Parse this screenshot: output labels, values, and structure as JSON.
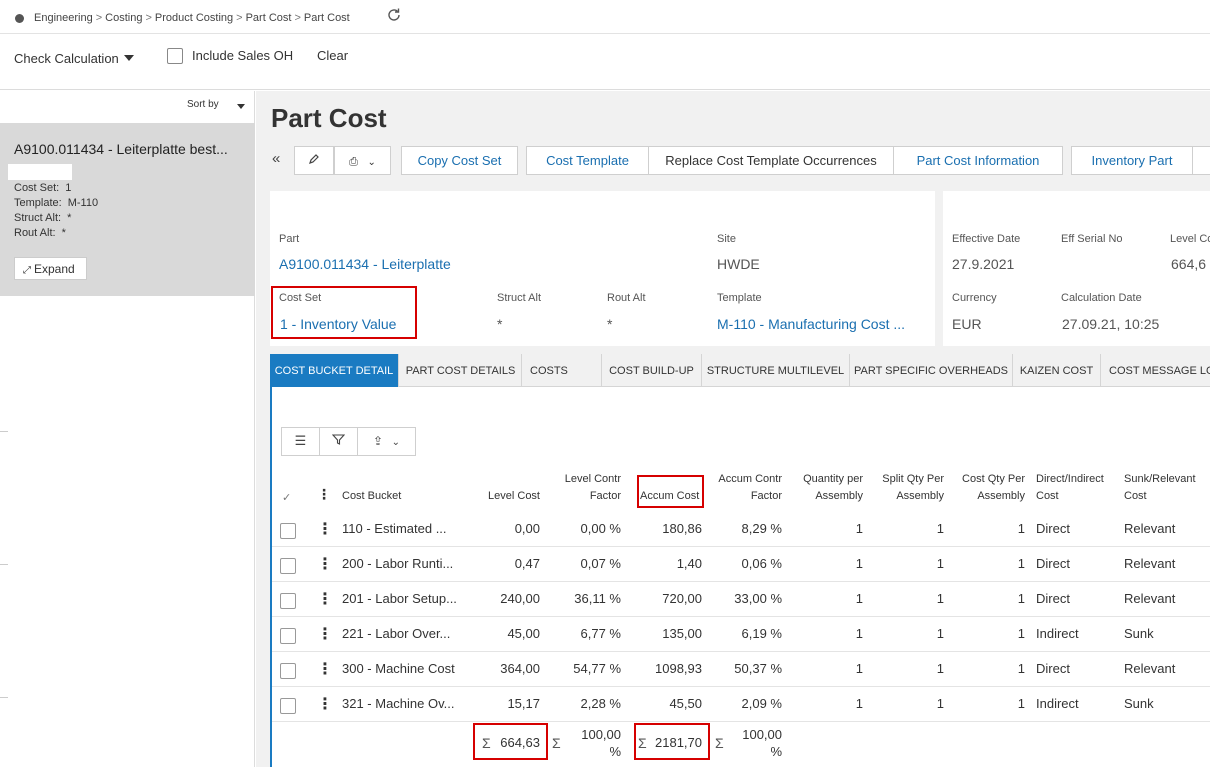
{
  "breadcrumb": [
    "Engineering",
    "Costing",
    "Product Costing",
    "Part Cost",
    "Part Cost"
  ],
  "toolbar": {
    "check_calc": "Check Calculation",
    "include_sales_oh": "Include Sales OH",
    "clear": "Clear"
  },
  "sidebar": {
    "sort_by": "Sort by",
    "card_title": "A9100.011434 - Leiterplatte best...",
    "cost_set_label": "Cost Set:",
    "cost_set_value": "1",
    "template_label": "Template:",
    "template_value": "M-110",
    "struct_alt_label": "Struct Alt:",
    "struct_alt_value": "*",
    "rout_alt_label": "Rout Alt:",
    "rout_alt_value": "*",
    "expand": "Expand"
  },
  "page": {
    "title": "Part Cost",
    "buttons": {
      "copy_cost_set": "Copy Cost Set",
      "cost_template": "Cost Template",
      "replace_template": "Replace Cost Template Occurrences",
      "part_cost_info": "Part Cost Information",
      "inventory_part": "Inventory Part"
    }
  },
  "details": {
    "part_label": "Part",
    "part_value": "A9100.011434 - Leiterplatte",
    "site_label": "Site",
    "site_value": "HWDE",
    "cost_set_label": "Cost Set",
    "cost_set_value": "1 - Inventory Value",
    "struct_alt_label": "Struct Alt",
    "struct_alt_value": "*",
    "rout_alt_label": "Rout Alt",
    "rout_alt_value": "*",
    "template_label": "Template",
    "template_value": "M-110 - Manufacturing Cost ...",
    "eff_date_label": "Effective Date",
    "eff_date_value": "27.9.2021",
    "eff_serial_label": "Eff Serial No",
    "level_cost_label": "Level Co",
    "level_cost_value": "664,6",
    "currency_label": "Currency",
    "currency_value": "EUR",
    "calc_date_label": "Calculation Date",
    "calc_date_value": "27.09.21, 10:25"
  },
  "tabs": [
    "COST BUCKET DETAIL",
    "PART COST DETAILS",
    "COSTS",
    "COST BUILD-UP",
    "STRUCTURE MULTILEVEL",
    "PART SPECIFIC OVERHEADS",
    "KAIZEN COST",
    "COST MESSAGE LO"
  ],
  "grid": {
    "headers": {
      "cost_bucket": "Cost Bucket",
      "level_cost": "Level Cost",
      "level_contr_1": "Level Contr",
      "level_contr_2": "Factor",
      "accum_cost": "Accum Cost",
      "accum_contr_1": "Accum Contr",
      "accum_contr_2": "Factor",
      "qty_per_1": "Quantity per",
      "qty_per_2": "Assembly",
      "split_qty_1": "Split Qty Per",
      "split_qty_2": "Assembly",
      "cost_qty_1": "Cost Qty Per",
      "cost_qty_2": "Assembly",
      "direct_1": "Direct/Indirect",
      "direct_2": "Cost",
      "sunk_1": "Sunk/Relevant",
      "sunk_2": "Cost"
    },
    "rows": [
      {
        "bucket": "110 - Estimated ...",
        "level_cost": "0,00",
        "level_factor": "0,00 %",
        "accum_cost": "180,86",
        "accum_factor": "8,29 %",
        "qty": "1",
        "split": "1",
        "cost_qty": "1",
        "direct": "Direct",
        "sunk": "Relevant"
      },
      {
        "bucket": "200 - Labor Runti...",
        "level_cost": "0,47",
        "level_factor": "0,07 %",
        "accum_cost": "1,40",
        "accum_factor": "0,06 %",
        "qty": "1",
        "split": "1",
        "cost_qty": "1",
        "direct": "Direct",
        "sunk": "Relevant"
      },
      {
        "bucket": "201 - Labor Setup...",
        "level_cost": "240,00",
        "level_factor": "36,11 %",
        "accum_cost": "720,00",
        "accum_factor": "33,00 %",
        "qty": "1",
        "split": "1",
        "cost_qty": "1",
        "direct": "Direct",
        "sunk": "Relevant"
      },
      {
        "bucket": "221 - Labor Over...",
        "level_cost": "45,00",
        "level_factor": "6,77 %",
        "accum_cost": "135,00",
        "accum_factor": "6,19 %",
        "qty": "1",
        "split": "1",
        "cost_qty": "1",
        "direct": "Indirect",
        "sunk": "Sunk"
      },
      {
        "bucket": "300 - Machine Cost",
        "level_cost": "364,00",
        "level_factor": "54,77 %",
        "accum_cost": "1098,93",
        "accum_factor": "50,37 %",
        "qty": "1",
        "split": "1",
        "cost_qty": "1",
        "direct": "Direct",
        "sunk": "Relevant"
      },
      {
        "bucket": "321 - Machine Ov...",
        "level_cost": "15,17",
        "level_factor": "2,28 %",
        "accum_cost": "45,50",
        "accum_factor": "2,09 %",
        "qty": "1",
        "split": "1",
        "cost_qty": "1",
        "direct": "Indirect",
        "sunk": "Sunk"
      }
    ],
    "totals": {
      "sigma": "Σ",
      "level_cost": "664,63",
      "level_factor_1": "100,00",
      "level_factor_2": "%",
      "accum_cost": "2181,70",
      "accum_factor_1": "100,00",
      "accum_factor_2": "%"
    }
  }
}
